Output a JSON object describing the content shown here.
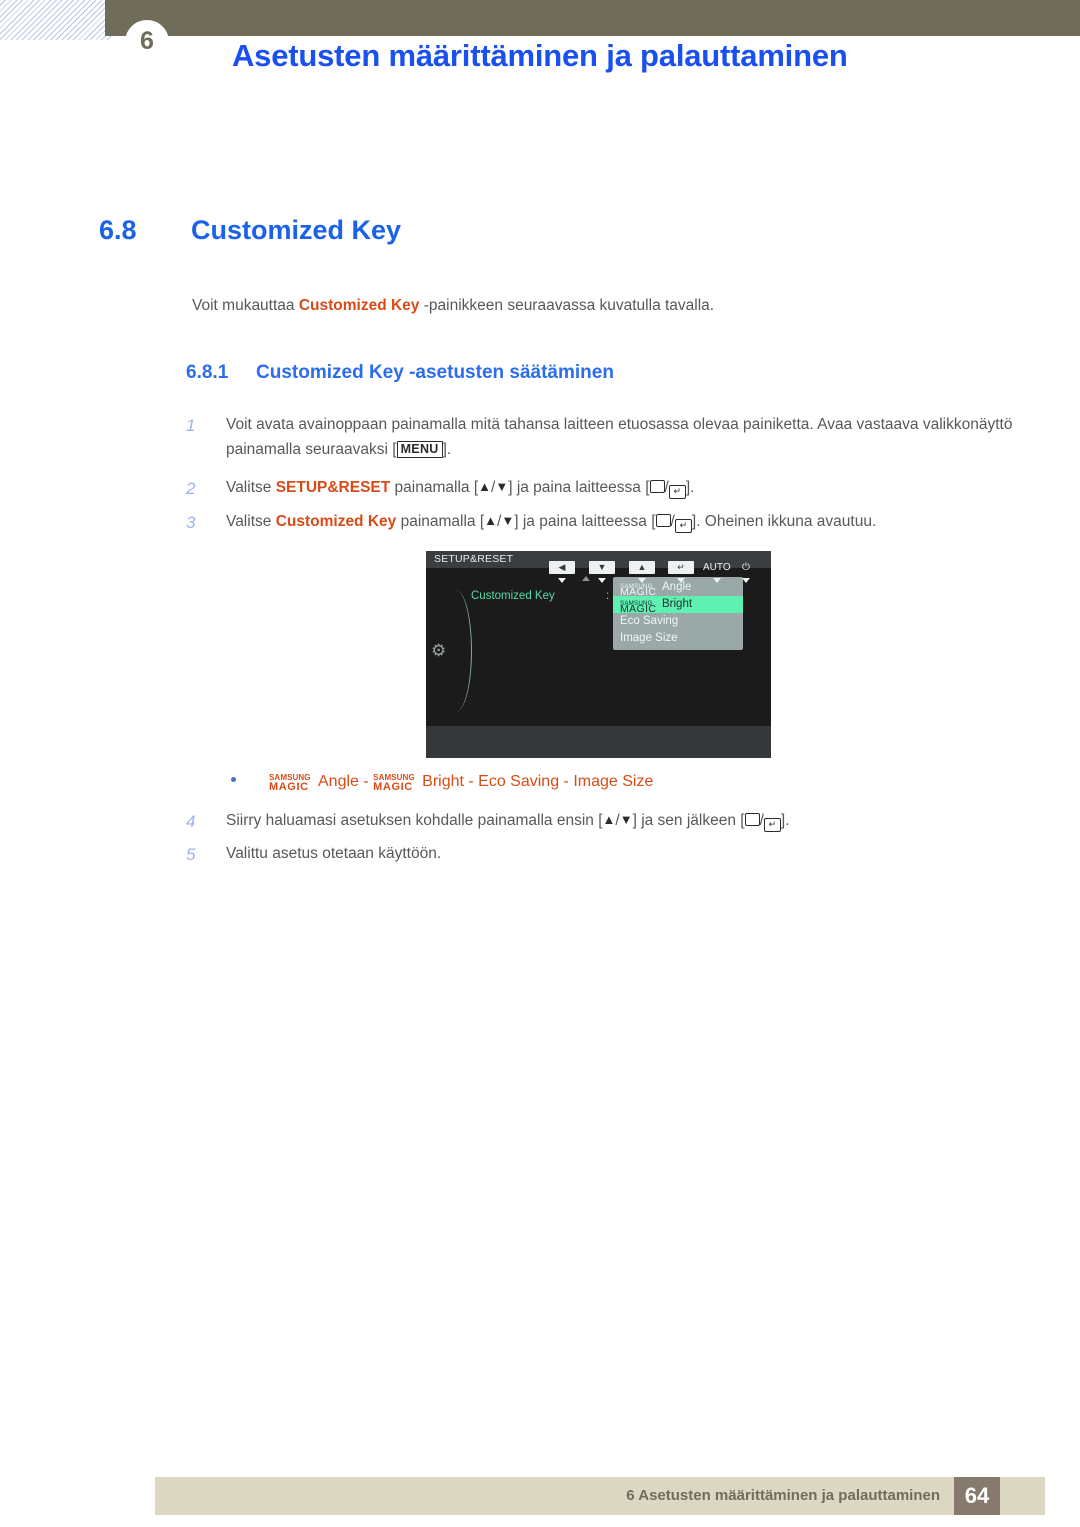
{
  "header": {
    "chapter_number": "6",
    "title": "Asetusten määrittäminen ja palauttaminen"
  },
  "section": {
    "number": "6.8",
    "title": "Customized Key",
    "intro_before": "Voit mukauttaa ",
    "intro_highlight": "Customized Key",
    "intro_after": " -painikkeen seuraavassa kuvatulla tavalla."
  },
  "subsection": {
    "number": "6.8.1",
    "title": "Customized Key -asetusten säätäminen"
  },
  "steps": [
    {
      "index": "1",
      "t1": "Voit avata avainoppaan painamalla mitä tahansa laitteen etuosassa olevaa painiketta. Avaa vastaava valikkonäyttö painamalla seuraavaksi [",
      "key": "MENU",
      "t2": "]."
    },
    {
      "index": "2",
      "t1": "Valitse ",
      "hl": "SETUP&RESET",
      "t2": " painamalla [",
      "t3": "] ja paina laitteessa [",
      "t4": "]."
    },
    {
      "index": "3",
      "t1": "Valitse ",
      "hl": "Customized Key",
      "t2": " painamalla [",
      "t3": "] ja paina laitteessa [",
      "t4": "]. Oheinen ikkuna avautuu."
    },
    {
      "index": "4",
      "t1": "Siirry haluamasi asetuksen kohdalle painamalla ensin [",
      "t2": "] ja sen jälkeen [",
      "t3": "]."
    },
    {
      "index": "5",
      "t1": "Valittu asetus otetaan käyttöön."
    }
  ],
  "osd": {
    "title": "SETUP&RESET",
    "label": "Customized Key",
    "colon": ":",
    "menu_items": [
      {
        "magic_top": "SAMSUNG",
        "magic_bottom": "MAGIC",
        "label": "Angle",
        "selected": false
      },
      {
        "magic_top": "SAMSUNG",
        "magic_bottom": "MAGIC",
        "label": "Bright",
        "selected": true
      },
      {
        "magic_top": "",
        "magic_bottom": "",
        "label": "Eco Saving",
        "selected": false
      },
      {
        "magic_top": "",
        "magic_bottom": "",
        "label": "Image Size",
        "selected": false
      }
    ],
    "buttons": [
      {
        "glyph": "◀",
        "type": "box"
      },
      {
        "glyph": "▼",
        "type": "box"
      },
      {
        "glyph": "▲",
        "type": "box"
      },
      {
        "glyph": "↵",
        "type": "box"
      },
      {
        "glyph": "AUTO",
        "type": "plain"
      },
      {
        "glyph": "⏻",
        "type": "plain"
      }
    ],
    "gear_icon": "gear-icon",
    "colors": {
      "background": "#1b1b1b",
      "titlebar": "#3a3e40",
      "menu_bg": "#9aa8a8",
      "selected": "#5ff0b4",
      "label_green": "#5ad9a8"
    }
  },
  "bullet": {
    "magic_top": "SAMSUNG",
    "magic_bottom": "MAGIC",
    "angle": "Angle",
    "sep1": " - ",
    "bright": "Bright",
    "sep2": " - ",
    "eco": "Eco Saving",
    "sep3": " - ",
    "size": "Image Size"
  },
  "footer": {
    "text": "6 Asetusten määrittäminen ja palauttaminen",
    "page": "64"
  },
  "colors": {
    "header_bar": "#6f6d59",
    "heading_blue": "#1a62e8",
    "title_blue": "#1a4ff0",
    "highlight_orange": "#d94b16",
    "body_gray": "#58585a",
    "step_number": "#9db3e8",
    "footer_bar": "#dcd7c3",
    "footer_page_box": "#857a6d"
  }
}
